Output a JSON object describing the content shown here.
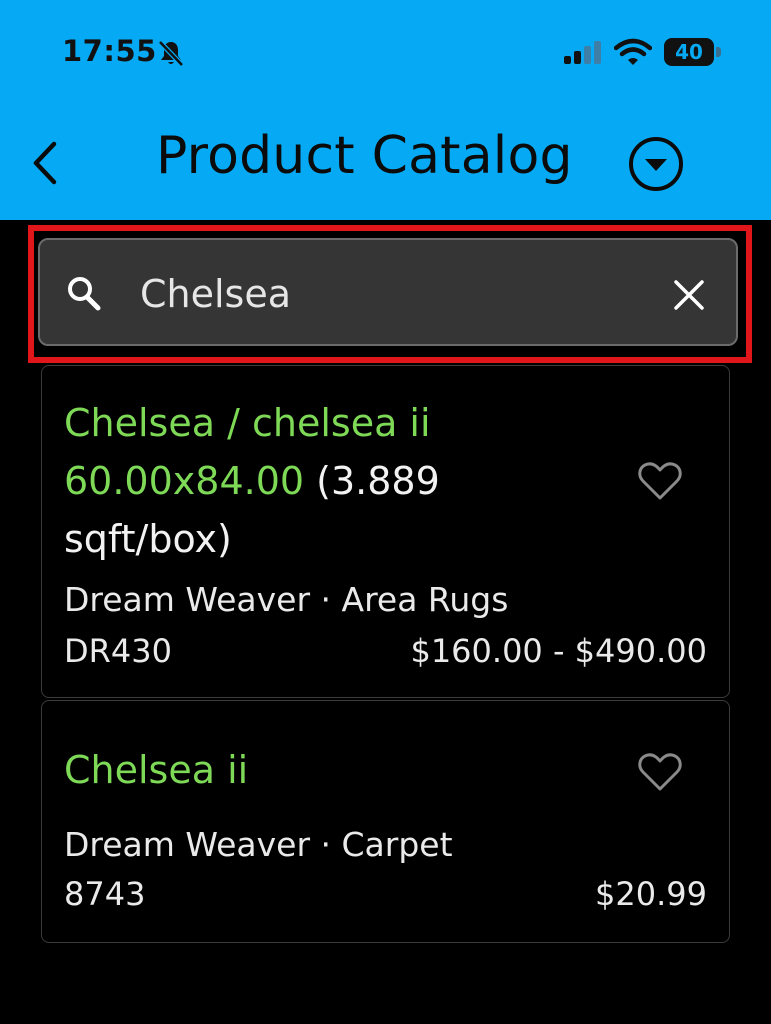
{
  "status_bar": {
    "time": "17:55",
    "battery": "40"
  },
  "header": {
    "title": "Product Catalog"
  },
  "search": {
    "value": "Chelsea"
  },
  "products": [
    {
      "name": "Chelsea / chelsea ii",
      "size": "60.00x84.00",
      "size_note": "(3.889 sqft/box)",
      "brand_category": "Dream Weaver · Area Rugs",
      "sku": "DR430",
      "price": "$160.00 - $490.00"
    },
    {
      "name": "Chelsea ii",
      "brand_category": "Dream Weaver · Carpet",
      "sku": "8743",
      "price": "$20.99"
    }
  ],
  "colors": {
    "header_bg": "#06aaf4",
    "accent_green": "#7ed957",
    "highlight_red": "#e0161a"
  }
}
